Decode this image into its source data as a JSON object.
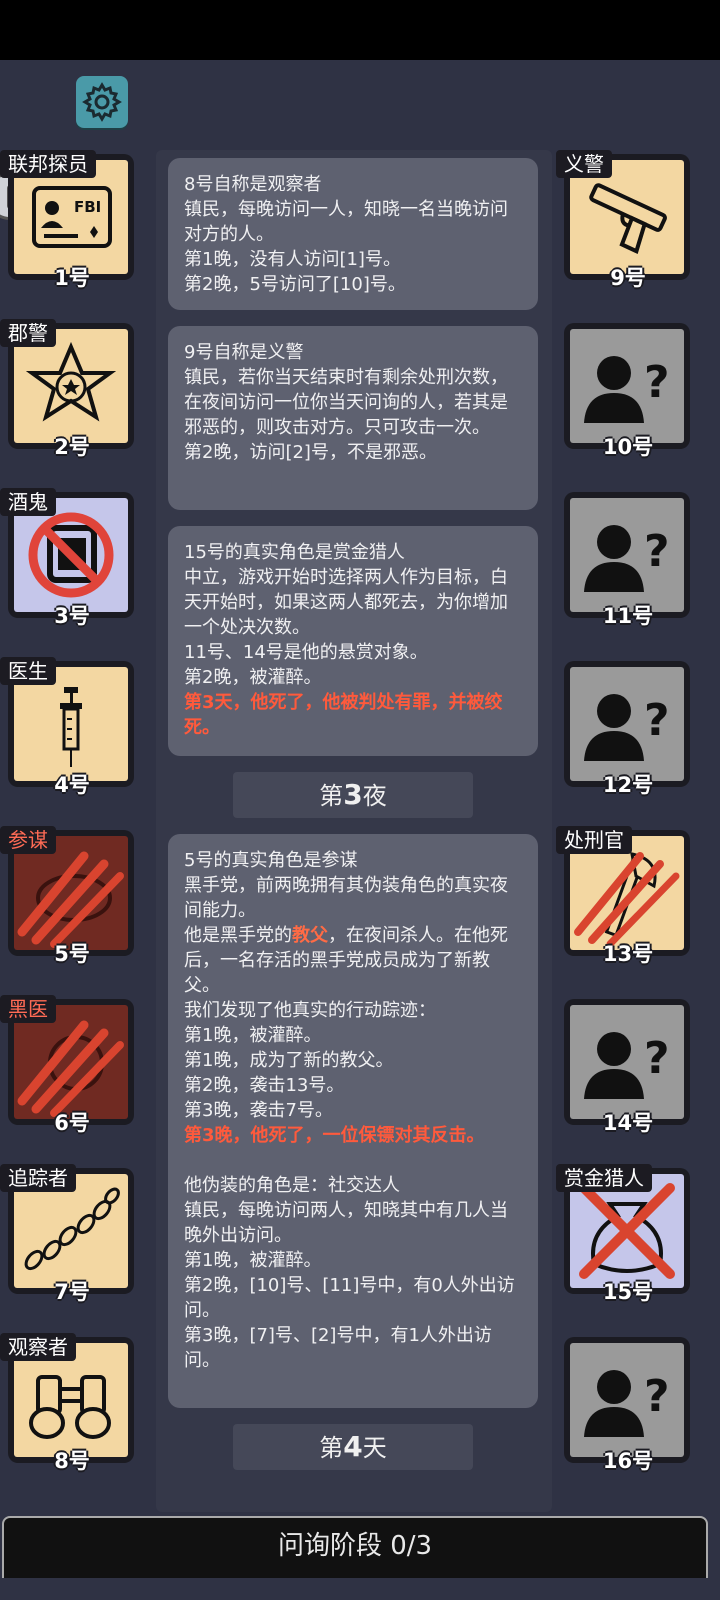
{
  "players_left": [
    {
      "role": "联邦探员",
      "seat": "1号",
      "icon": "fbi-badge-icon"
    },
    {
      "role": "郡警",
      "seat": "2号",
      "icon": "sheriff-star-icon"
    },
    {
      "role": "酒鬼",
      "seat": "3号",
      "icon": "fake-stamp-icon"
    },
    {
      "role": "医生",
      "seat": "4号",
      "icon": "syringe-icon"
    },
    {
      "role": "参谋",
      "seat": "5号",
      "icon": "claw-dead-icon"
    },
    {
      "role": "黑医",
      "seat": "6号",
      "icon": "claw-dead-icon"
    },
    {
      "role": "追踪者",
      "seat": "7号",
      "icon": "footprints-icon"
    },
    {
      "role": "观察者",
      "seat": "8号",
      "icon": "binoculars-icon"
    }
  ],
  "players_right": [
    {
      "role": "义警",
      "seat": "9号",
      "icon": "pistol-icon"
    },
    {
      "role": "",
      "seat": "10号",
      "icon": "unknown-person-icon"
    },
    {
      "role": "",
      "seat": "11号",
      "icon": "unknown-person-icon"
    },
    {
      "role": "",
      "seat": "12号",
      "icon": "unknown-person-icon"
    },
    {
      "role": "处刑官",
      "seat": "13号",
      "icon": "axe-claw-icon"
    },
    {
      "role": "",
      "seat": "14号",
      "icon": "unknown-person-icon"
    },
    {
      "role": "赏金猎人",
      "seat": "15号",
      "icon": "moneybag-crossed-icon"
    },
    {
      "role": "",
      "seat": "16号",
      "icon": "unknown-person-icon"
    }
  ],
  "messages": {
    "m1": {
      "l1": "8号自称是观察者",
      "l2": "镇民，每晚访问一人，知晓一名当晚访问对方的人。",
      "l3": "第1晚，没有人访问[1]号。",
      "l4": "第2晚，5号访问了[10]号。"
    },
    "m2": {
      "l1": "9号自称是义警",
      "l2": "镇民，若你当天结束时有剩余处刑次数，在夜间访问一位你当天问询的人，若其是邪恶的，则攻击对方。只可攻击一次。",
      "l3": "第2晚，访问[2]号，不是邪恶。"
    },
    "m3": {
      "l1": "15号的真实角色是赏金猎人",
      "l2": "中立，游戏开始时选择两人作为目标，白天开始时，如果这两人都死去，为你增加一个处决次数。",
      "l3": "11号、14号是他的悬赏对象。",
      "l4": "第2晚，被灌醉。",
      "l5": "第3天，他死了，他被判处有罪，并被绞死。"
    },
    "m4": {
      "l1": "5号的真实角色是参谋",
      "l2": "黑手党，前两晚拥有其伪装角色的真实夜间能力。",
      "l3a": "他是黑手党的",
      "l3b": "教父",
      "l3c": "，在夜间杀人。在他死后，一名存活的黑手党成员成为了新教父。",
      "l4": "我们发现了他真实的行动踪迹：",
      "l5": "第1晚，被灌醉。",
      "l6": "第1晚，成为了新的教父。",
      "l7": "第2晚，袭击13号。",
      "l8": "第3晚，袭击7号。",
      "l9": "第3晚，他死了，一位保镖对其反击。",
      "l10": "他伪装的角色是：社交达人",
      "l11": "镇民，每晚访问两人，知晓其中有几人当晚外出访问。",
      "l12": "第1晚，被灌醉。",
      "l13": "第2晚，[10]号、[11]号中，有0人外出访问。",
      "l14": "第3晚，[7]号、[2]号中，有1人外出访问。"
    }
  },
  "dividers": {
    "night3": {
      "pre": "第",
      "num": "3",
      "post": "夜"
    },
    "day4": {
      "pre": "第",
      "num": "4",
      "post": "天"
    }
  },
  "bottom": {
    "phase_label": "问询阶段 0/3"
  },
  "colors": {
    "accent_red": "#ff5a3c",
    "card_cream": "#f3d7a2",
    "unknown_gray": "#9a9a9a",
    "settings_teal": "#4a9aa8"
  }
}
